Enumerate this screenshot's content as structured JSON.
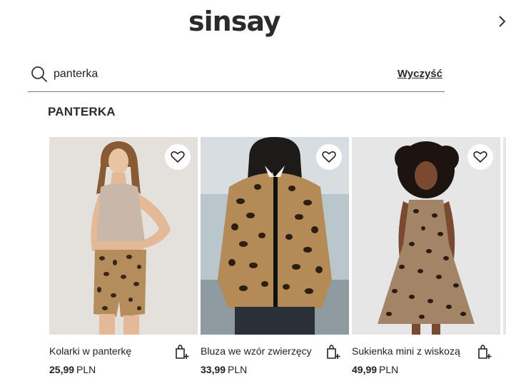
{
  "header": {
    "logo_text": "sinsay",
    "next_icon": "chevron-right-icon"
  },
  "search": {
    "icon": "search-icon",
    "value": "panterka",
    "clear_label": "Wyczyść"
  },
  "section": {
    "title": "PANTERKA"
  },
  "products": [
    {
      "name": "Kolarki w panterkę",
      "price": "25,99",
      "currency": "PLN",
      "fav_icon": "heart-icon",
      "cart_icon": "add-to-cart-icon"
    },
    {
      "name": "Bluza we wzór zwierzęcy",
      "price": "33,99",
      "currency": "PLN",
      "fav_icon": "heart-icon",
      "cart_icon": "add-to-cart-icon"
    },
    {
      "name": "Sukienka mini z wiskozą",
      "price": "49,99",
      "currency": "PLN",
      "fav_icon": "heart-icon",
      "cart_icon": "add-to-cart-icon"
    }
  ],
  "colors": {
    "text": "#222222",
    "divider": "#7a7a7a",
    "card_bg": "#e9e7e4"
  }
}
